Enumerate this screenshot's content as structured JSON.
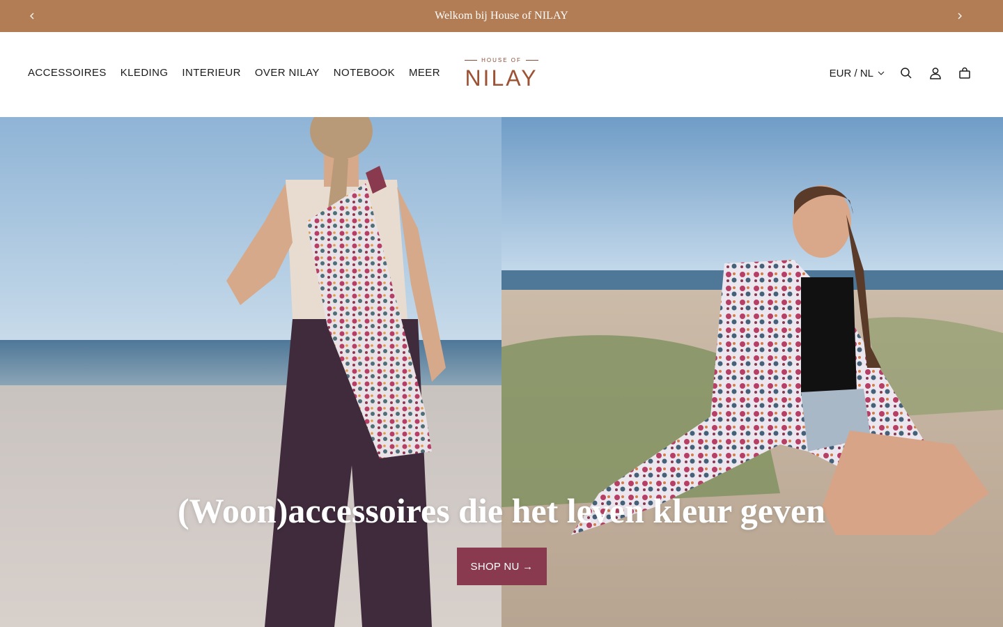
{
  "announcement": {
    "text": "Welkom bij House of NILAY",
    "prev_icon": "chevron-left-icon",
    "next_icon": "chevron-right-icon"
  },
  "header": {
    "nav": [
      {
        "label": "ACCESSOIRES"
      },
      {
        "label": "KLEDING"
      },
      {
        "label": "INTERIEUR"
      },
      {
        "label": "OVER NILAY"
      },
      {
        "label": "NOTEBOOK"
      },
      {
        "label": "MEER"
      }
    ],
    "logo": {
      "small": "HOUSE OF",
      "big": "NILAY"
    },
    "locale": "EUR / NL",
    "icons": [
      "search-icon",
      "account-icon",
      "cart-icon"
    ]
  },
  "hero": {
    "title": "(Woon)accessoires die het leven kleur geven",
    "cta": "SHOP NU →"
  },
  "colors": {
    "announcement_bg": "#b27c54",
    "brand": "#9c5234",
    "cta_bg": "#8a3a4e"
  }
}
